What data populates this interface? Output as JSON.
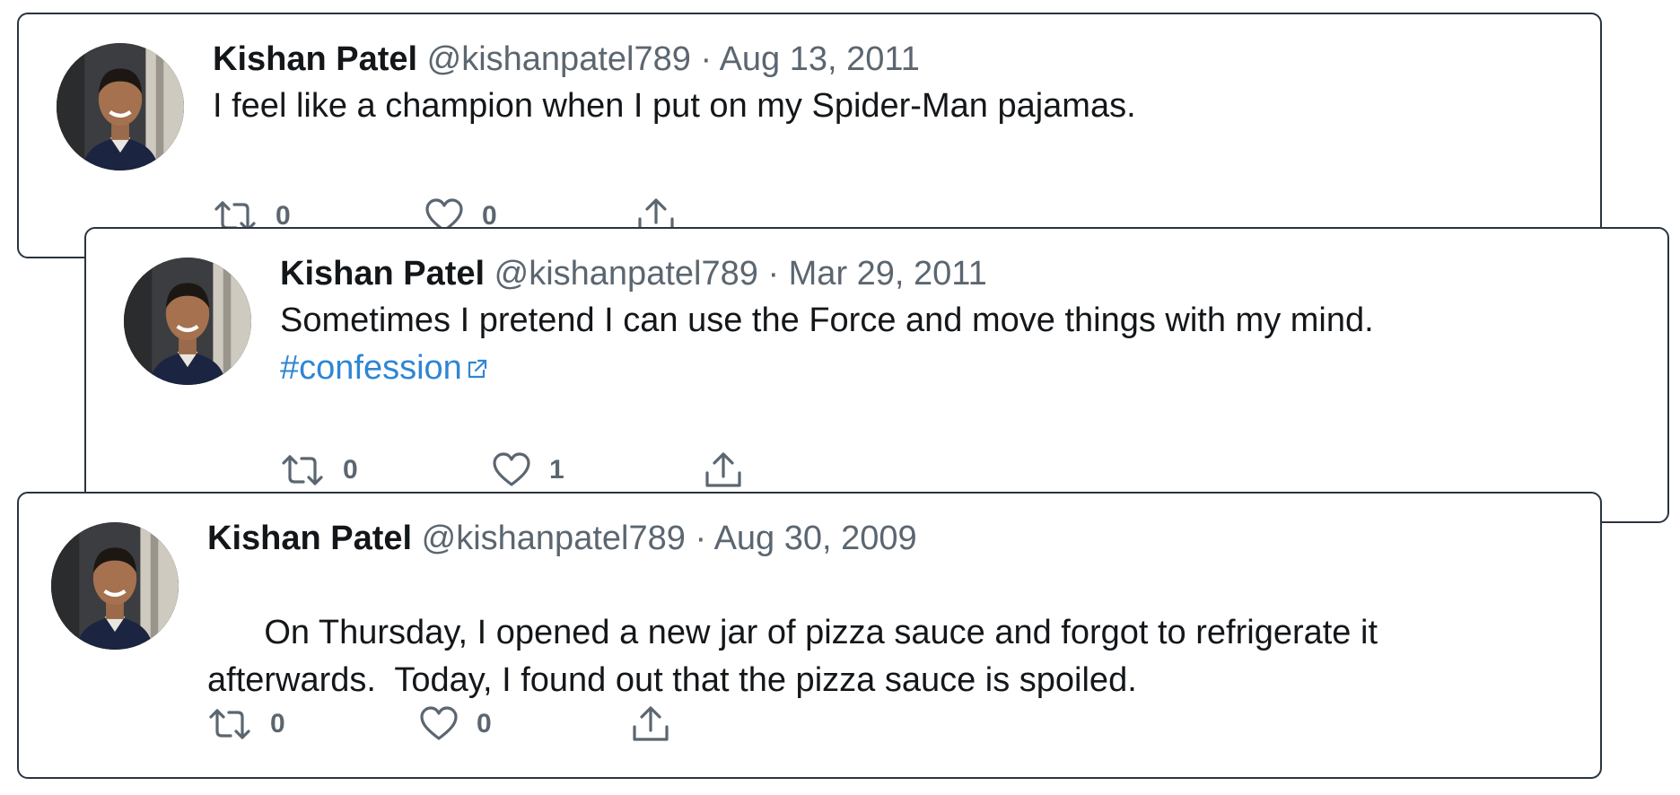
{
  "tweets": [
    {
      "author": "Kishan Patel",
      "handle": "@kishanpatel789",
      "separator": "·",
      "date": "Aug 13, 2011",
      "text": "I feel like a champion when I put on my Spider-Man pajamas.",
      "hashtag": "",
      "retweets": "0",
      "likes": "0"
    },
    {
      "author": "Kishan Patel",
      "handle": "@kishanpatel789",
      "separator": "·",
      "date": "Mar 29, 2011",
      "text": "Sometimes I pretend I can use the Force and move things with my mind.",
      "hashtag": "#confession",
      "retweets": "0",
      "likes": "1"
    },
    {
      "author": "Kishan Patel",
      "handle": "@kishanpatel789",
      "separator": "·",
      "date": "Aug 30, 2009",
      "text": "On Thursday, I opened a new jar of pizza sauce and forgot to refrigerate it afterwards.  Today, I found out that the pizza sauce is spoiled.",
      "hashtag": "",
      "retweets": "0",
      "likes": "0"
    }
  ],
  "icons": {
    "retweet": "retweet-icon",
    "like": "heart-icon",
    "share": "share-icon",
    "external_link": "external-link-icon"
  },
  "colors": {
    "text": "#14171a",
    "secondary": "#5b6670",
    "hashtag": "#2f86d3",
    "border": "#2a3440"
  }
}
